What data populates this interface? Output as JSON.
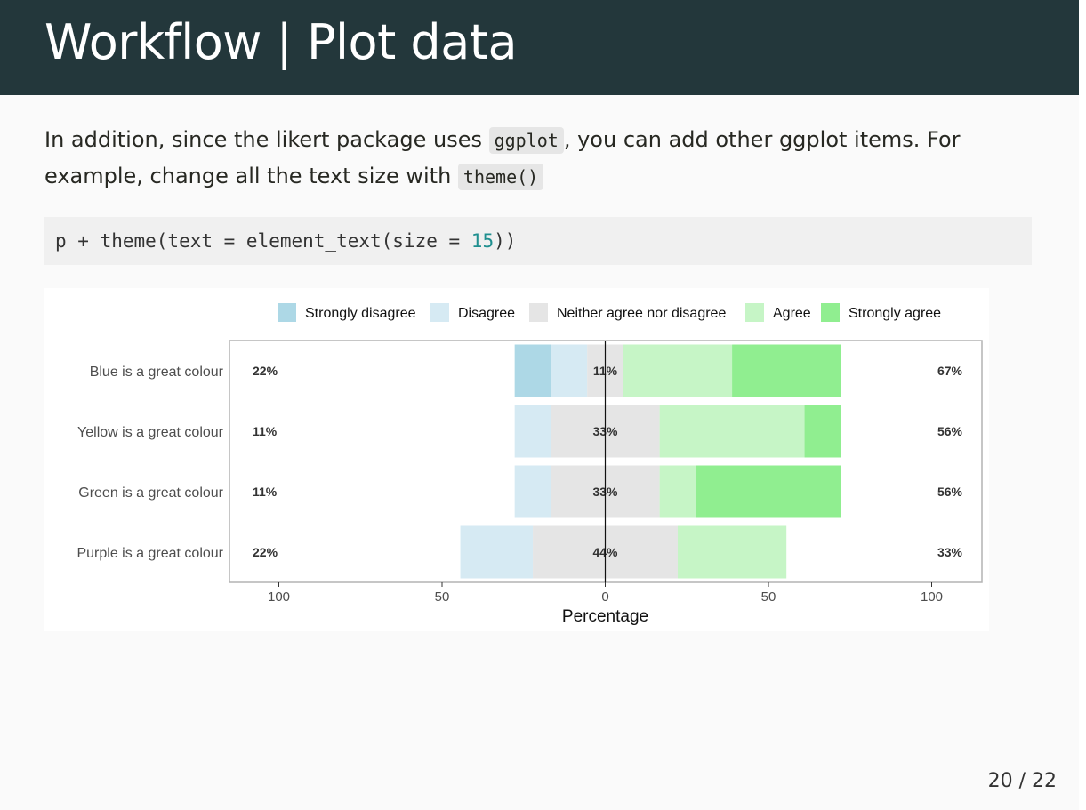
{
  "slide": {
    "title": "Workflow | Plot data",
    "body": {
      "part1": "In addition, since the likert package uses ",
      "code1": "ggplot",
      "part2": ", you can add other ggplot items. For example, change all the text size with ",
      "code2": "theme()"
    },
    "code": {
      "before": "p + theme(text = element_text(size = ",
      "number": "15",
      "after": "))"
    },
    "page_number": "20 / 22"
  },
  "chart_data": {
    "type": "bar",
    "orientation": "horizontal-diverging",
    "xlabel": "Percentage",
    "xlim": [
      -100,
      100
    ],
    "x_ticks": [
      {
        "value": -100,
        "label": "100"
      },
      {
        "value": -50,
        "label": "50"
      },
      {
        "value": 0,
        "label": "0"
      },
      {
        "value": 50,
        "label": "50"
      },
      {
        "value": 100,
        "label": "100"
      }
    ],
    "legend_position": "top",
    "categories": [
      "Blue is a great colour",
      "Yellow is a great colour",
      "Green is a great colour",
      "Purple is a great colour"
    ],
    "series": [
      {
        "name": "Strongly disagree",
        "color": "#add8e6",
        "values": [
          11.1,
          0,
          0,
          0
        ]
      },
      {
        "name": "Disagree",
        "color": "#d6eaf3",
        "values": [
          11.1,
          11.1,
          11.1,
          22.2
        ]
      },
      {
        "name": "Neither agree nor disagree",
        "color": "#e5e5e5",
        "values": [
          11.1,
          33.3,
          33.3,
          44.4
        ]
      },
      {
        "name": "Agree",
        "color": "#c6f5c6",
        "values": [
          33.3,
          44.4,
          11.1,
          33.3
        ]
      },
      {
        "name": "Strongly agree",
        "color": "#90ee90",
        "values": [
          33.3,
          11.1,
          44.4,
          0
        ]
      }
    ],
    "low_labels": [
      "22%",
      "11%",
      "11%",
      "22%"
    ],
    "neutral_labels": [
      "11%",
      "33%",
      "33%",
      "44%"
    ],
    "high_labels": [
      "67%",
      "56%",
      "56%",
      "33%"
    ]
  }
}
